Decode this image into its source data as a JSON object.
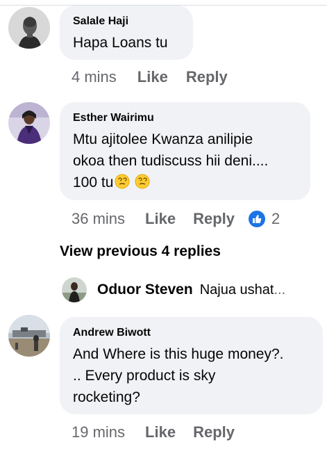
{
  "comments": [
    {
      "author": "Salale Haji",
      "text": "Hapa Loans tu",
      "time": "4 mins",
      "like_label": "Like",
      "reply_label": "Reply"
    },
    {
      "author": "Esther Wairimu",
      "text_lines": [
        "Mtu ajitolee Kwanza anilipie",
        "okoa then tudiscuss hii deni....",
        "100 tu"
      ],
      "emoji": "face-with-spiral-eyes-emoji",
      "emoji_count": 2,
      "time": "36 mins",
      "like_label": "Like",
      "reply_label": "Reply",
      "reaction_type": "like",
      "reaction_count": "2"
    },
    {
      "author": "Andrew Biwott",
      "text_lines": [
        "And Where is this huge money?.",
        ".. Every product is sky",
        "rocketing?"
      ],
      "time": "19 mins",
      "like_label": "Like",
      "reply_label": "Reply"
    }
  ],
  "view_previous": "View previous 4 replies",
  "reply_preview": {
    "author": "Oduor Steven",
    "text": "Najua ushat",
    "ellipsis": "..."
  },
  "colors": {
    "bubble": "#f0f2f5",
    "text": "#050505",
    "secondary": "#65676b",
    "like_blue": "#1b74e4"
  }
}
